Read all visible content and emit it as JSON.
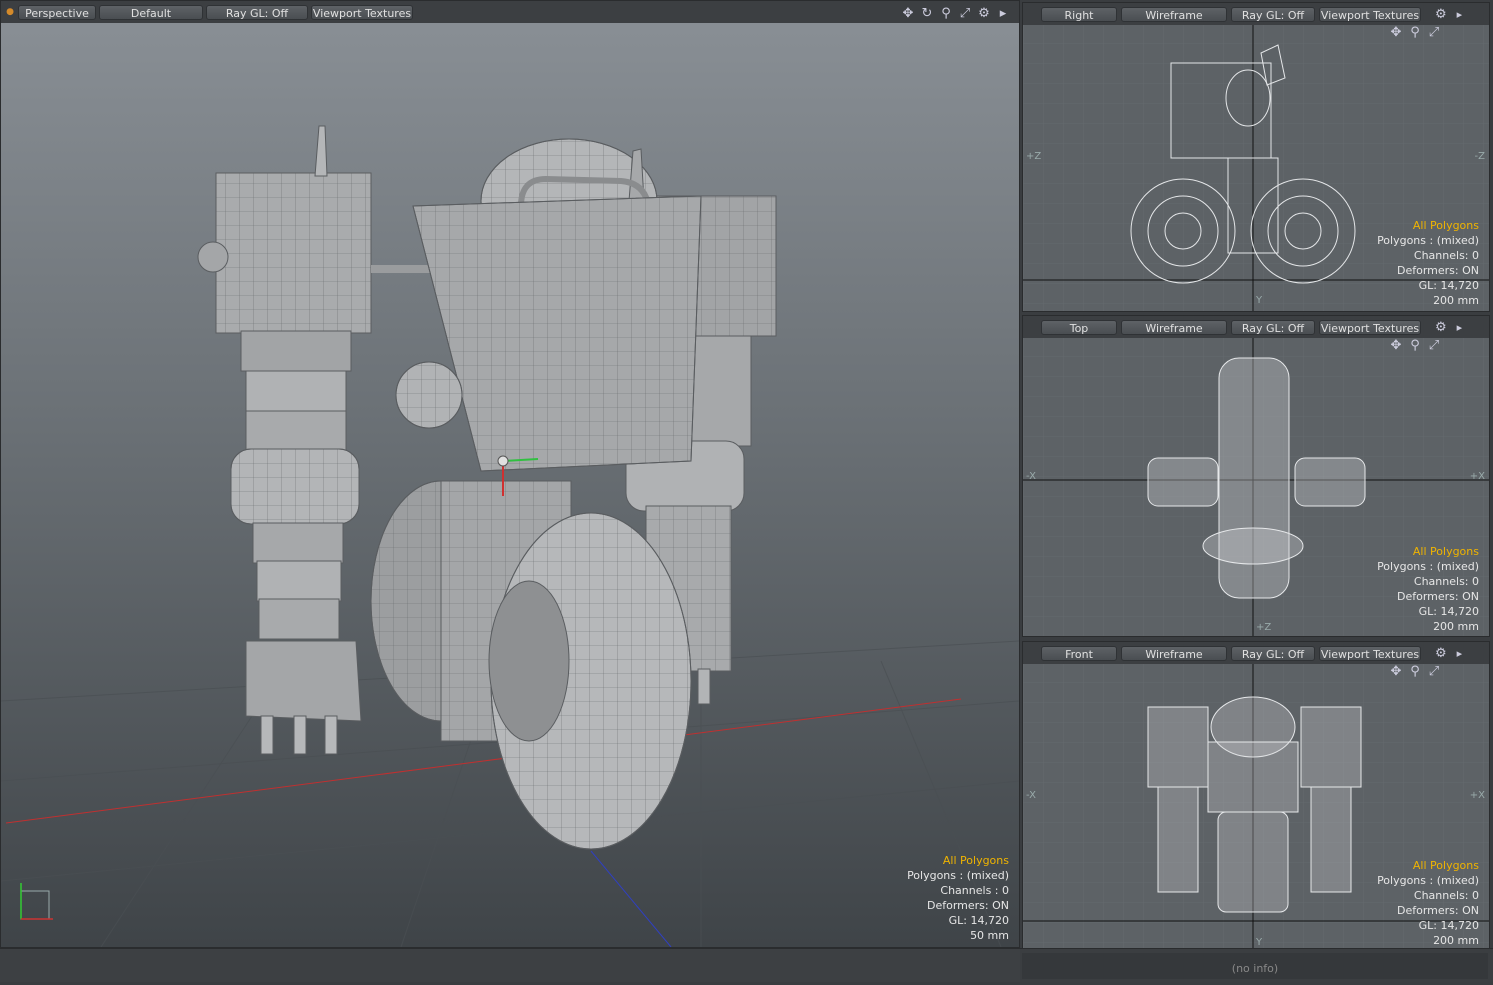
{
  "perspective_vp": {
    "toolbar": [
      "Perspective",
      "Default",
      "Ray GL: Off",
      "Viewport Textures"
    ],
    "info": {
      "selection": "All Polygons",
      "polygons": "Polygons : (mixed)",
      "channels": "Channels : 0",
      "deformers": "Deformers: ON",
      "gl": "GL: 14,720",
      "scale": "50 mm"
    },
    "icons": [
      "move-icon",
      "rotate-icon",
      "zoom-icon",
      "maximize-icon",
      "gear-icon",
      "menu-arrow-icon"
    ]
  },
  "right_vp": {
    "toolbar": [
      "Right",
      "Wireframe",
      "Ray GL: Off",
      "Viewport Textures"
    ],
    "axes": {
      "left": "+Z",
      "right": "-Z",
      "bottom": "Y"
    },
    "info": {
      "selection": "All Polygons",
      "polygons": "Polygons : (mixed)",
      "channels": "Channels: 0",
      "deformers": "Deformers: ON",
      "gl": "GL: 14,720",
      "scale": "200 mm"
    }
  },
  "top_vp": {
    "toolbar": [
      "Top",
      "Wireframe",
      "Ray GL: Off",
      "Viewport Textures"
    ],
    "axes": {
      "left": "-X",
      "right": "+X",
      "bottom": "+Z"
    },
    "info": {
      "selection": "All Polygons",
      "polygons": "Polygons : (mixed)",
      "channels": "Channels: 0",
      "deformers": "Deformers: ON",
      "gl": "GL: 14,720",
      "scale": "200 mm"
    }
  },
  "front_vp": {
    "toolbar": [
      "Front",
      "Wireframe",
      "Ray GL: Off",
      "Viewport Textures"
    ],
    "axes": {
      "left": "-X",
      "right": "+X",
      "bottom": "Y"
    },
    "info": {
      "selection": "All Polygons",
      "polygons": "Polygons : (mixed)",
      "channels": "Channels: 0",
      "deformers": "Deformers: ON",
      "gl": "GL: 14,720",
      "scale": "200 mm"
    }
  },
  "status": {
    "info_text": "(no info)"
  },
  "colors": {
    "accent": "#f0b400",
    "menu_dot": "#d48a2a"
  }
}
